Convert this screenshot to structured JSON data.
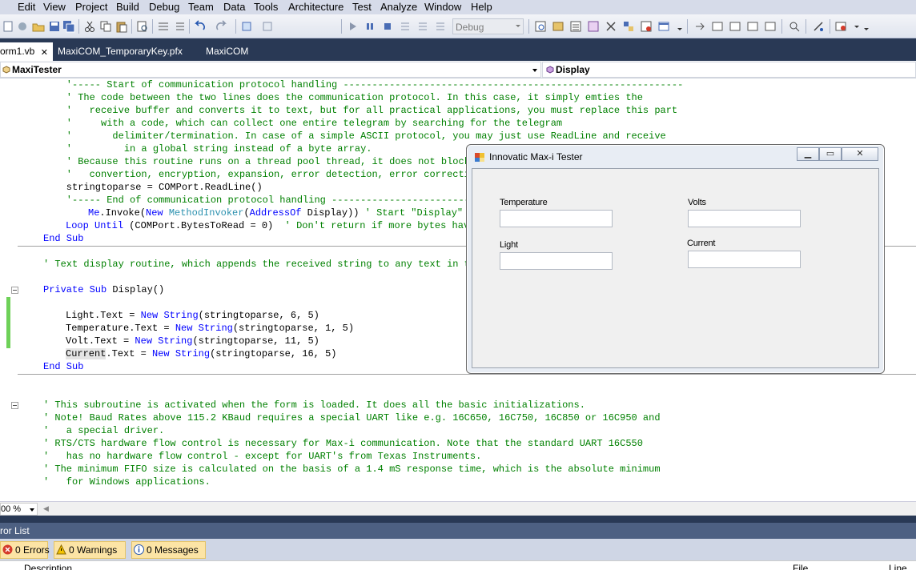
{
  "menu": {
    "items": [
      "Edit",
      "View",
      "Project",
      "Build",
      "Debug",
      "Team",
      "Data",
      "Tools",
      "Architecture",
      "Test",
      "Analyze",
      "Window",
      "Help"
    ]
  },
  "toolbar": {
    "configuration": "Debug"
  },
  "tabs": [
    {
      "label": "orm1.vb",
      "active": true
    },
    {
      "label": "MaxiCOM_TemporaryKey.pfx",
      "active": false
    },
    {
      "label": "MaxiCOM",
      "active": false
    }
  ],
  "navbar": {
    "class_selector": "MaxiTester",
    "member_selector": "Display"
  },
  "code": {
    "lines_a": [
      "    '----- Start of communication protocol handling -----------------------------------------------------------",
      "    ' The code between the two lines does the communication protocol. In this case, it simply emties the",
      "    '   receive buffer and converts it to text, but for all practical applications, you must replace this part",
      "    '     with a code, which can collect one entire telegram by searching for the telegram",
      "    '       delimiter/termination. In case of a simple ASCII protocol, you may just use ReadLine and receive",
      "    '         in a global string instead of a byte array.",
      "    ' Because this routine runs on a thread pool thread, it does not block the UI, so you do not have any need",
      "    '   convertion, encryption, expansion, error detection, error correction etc. can also be done here."
    ],
    "readline": {
      "pre": "    stringtoparse = COMPort.ReadLine()"
    },
    "end_line": "    '----- End of communication protocol handling -------------------------------------------------------------",
    "invoke": {
      "me": "Me",
      "dot": ".Invoke(",
      "new": "New",
      "sp": " ",
      "type": "MethodInvoker",
      "open": "(",
      "addr": "AddressOf",
      "rest": " Display)) ",
      "comment": "' Start \"Display\" on the UI thread"
    },
    "loop": {
      "kw1": "Loop",
      "sp": " ",
      "kw2": "Until",
      "rest": " (COMPort.BytesToRead = 0)  ",
      "comment": "' Don't return if more bytes have become available in the meantime"
    },
    "end_sub": "End Sub",
    "display_comment": "' Text display routine, which appends the received string to any text in the Received TextBox.",
    "private_sub": {
      "kw": "Private Sub",
      "rest": " Display()"
    },
    "assignments": [
      {
        "target": "Light",
        "mid": ".Text = ",
        "args": "(stringtoparse, 6, 5)"
      },
      {
        "target": "Temperature",
        "mid": ".Text = ",
        "args": "(stringtoparse, 1, 5)"
      },
      {
        "target": "Volt",
        "mid": ".Text = ",
        "args": "(stringtoparse, 11, 5)"
      },
      {
        "target": "Current",
        "mid": ".Text = ",
        "args": "(stringtoparse, 16, 5)"
      }
    ],
    "kw_new": "New",
    "kw_string": "String",
    "comments_b": [
      "' This subroutine is activated when the form is loaded. It does all the basic initializations.",
      "' Note! Baud Rates above 115.2 KBaud requires a special UART like e.g. 16C650, 16C750, 16C850 or 16C950 and",
      "'   a special driver.",
      "' RTS/CTS hardware flow control is necessary for Max-i communication. Note that the standard UART 16C550",
      "'   has no hardware flow control - except for UART's from Texas Instruments.",
      "' The minimum FIFO size is calculated on the basis of a 1.4 mS response time, which is the absolute minimum",
      "'   for Windows applications."
    ]
  },
  "zoom": "00 %",
  "error_list": {
    "title": "ror List",
    "errors": "0 Errors",
    "warnings": "0 Warnings",
    "messages": "0 Messages",
    "col_description": "Description",
    "col_file": "File",
    "col_line": "Line"
  },
  "form_window": {
    "title": "Innovatic Max-i Tester",
    "fields": {
      "temperature_label": "Temperature",
      "volts_label": "Volts",
      "light_label": "Light",
      "current_label": "Current"
    }
  }
}
